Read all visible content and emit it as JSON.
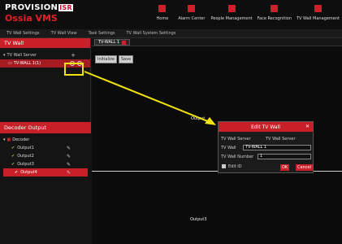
{
  "header": {
    "brand": "PROVISION",
    "brand_suffix": "ISR",
    "product": "Ossia VMS",
    "nav": [
      {
        "label": "Home",
        "icon": "home-icon"
      },
      {
        "label": "Alarm Center",
        "icon": "alarm-icon"
      },
      {
        "label": "People Management",
        "icon": "people-icon"
      },
      {
        "label": "Face Recognition",
        "icon": "face-recognition-icon"
      },
      {
        "label": "TV Wall Management",
        "icon": "tv-wall-icon"
      }
    ]
  },
  "tabs": [
    "TV Wall Settings",
    "TV Wall View",
    "Task Settings",
    "TV Wall System Settings"
  ],
  "left": {
    "title": "TV Wall",
    "tree_root": "TV Wall Server",
    "tree_item": "TV-WALL 1(1)",
    "decoder_title": "Decoder Output",
    "decoder_root": "Decoder",
    "outputs": [
      "Output1",
      "Output2",
      "Output3",
      "Output4"
    ]
  },
  "main": {
    "wall_tab": "TV-WALL 1",
    "toolbar": {
      "init_label": "Initialize",
      "save_label": "Save"
    },
    "output_top": "Output",
    "output_bottom": "Output3"
  },
  "dialog": {
    "title": "Edit TV Wall",
    "server_label": "TV Wall Server",
    "server_value": "TV Wall Server",
    "name_label": "TV Wall",
    "name_value": "TV-WALL 1",
    "number_label": "TV Wall Number",
    "number_value": "1",
    "edit_id_label": "Edit ID",
    "ok": "OK",
    "cancel": "Cancel"
  },
  "colors": {
    "accent": "#c91f28",
    "highlight": "#f2e310"
  }
}
